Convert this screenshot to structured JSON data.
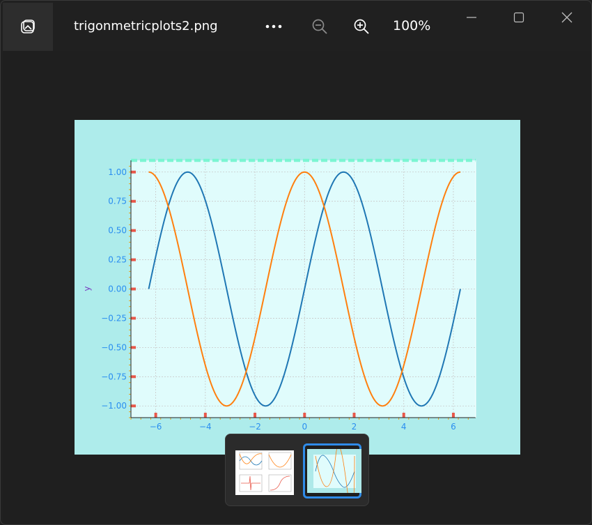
{
  "titlebar": {
    "filename": "trigonmetricplots2.png",
    "zoom_level": "100%",
    "icons": {
      "app": "photos-app-icon",
      "more": "more-options-icon",
      "zoom_out": "zoom-out-icon",
      "zoom_in": "zoom-in-icon",
      "minimize": "minimize-icon",
      "maximize": "maximize-icon",
      "close": "close-icon"
    }
  },
  "colors": {
    "figure_bg": "#aeeceb",
    "axes_bg": "#e0fcfc",
    "sin_line": "#1f77b4",
    "cos_line": "#ff7f0e",
    "tick_label": "#2a8ef0",
    "ylabel": "#7a3fc0",
    "tick_marks": "#e8584a",
    "top_spine": "#7cf5d2",
    "selection_border": "#2f8be8"
  },
  "chart_data": {
    "type": "line",
    "title": "",
    "xlabel": "",
    "ylabel": "y",
    "xlim": [
      -7,
      6.9
    ],
    "ylim": [
      -1.1,
      1.1
    ],
    "xticks": [
      -6,
      -4,
      -2,
      0,
      2,
      4,
      6
    ],
    "xtick_labels": [
      "−6",
      "−4",
      "−2",
      "0",
      "2",
      "4",
      "6"
    ],
    "yticks": [
      1.0,
      0.75,
      0.5,
      0.25,
      0.0,
      -0.25,
      -0.5,
      -0.75,
      -1.0
    ],
    "ytick_labels": [
      "1.00",
      "0.75",
      "0.50",
      "0.25",
      "0.00",
      "−0.25",
      "−0.50",
      "−0.75",
      "−1.00"
    ],
    "grid": true,
    "x_domain": [
      -6.2832,
      6.2832
    ],
    "series": [
      {
        "function": "sin(x)",
        "color": "#1f77b4"
      },
      {
        "function": "cos(x)",
        "color": "#ff7f0e"
      }
    ]
  },
  "filmstrip": {
    "items": [
      {
        "name": "thumbnail-1",
        "selected": false
      },
      {
        "name": "thumbnail-2",
        "selected": true
      }
    ]
  }
}
